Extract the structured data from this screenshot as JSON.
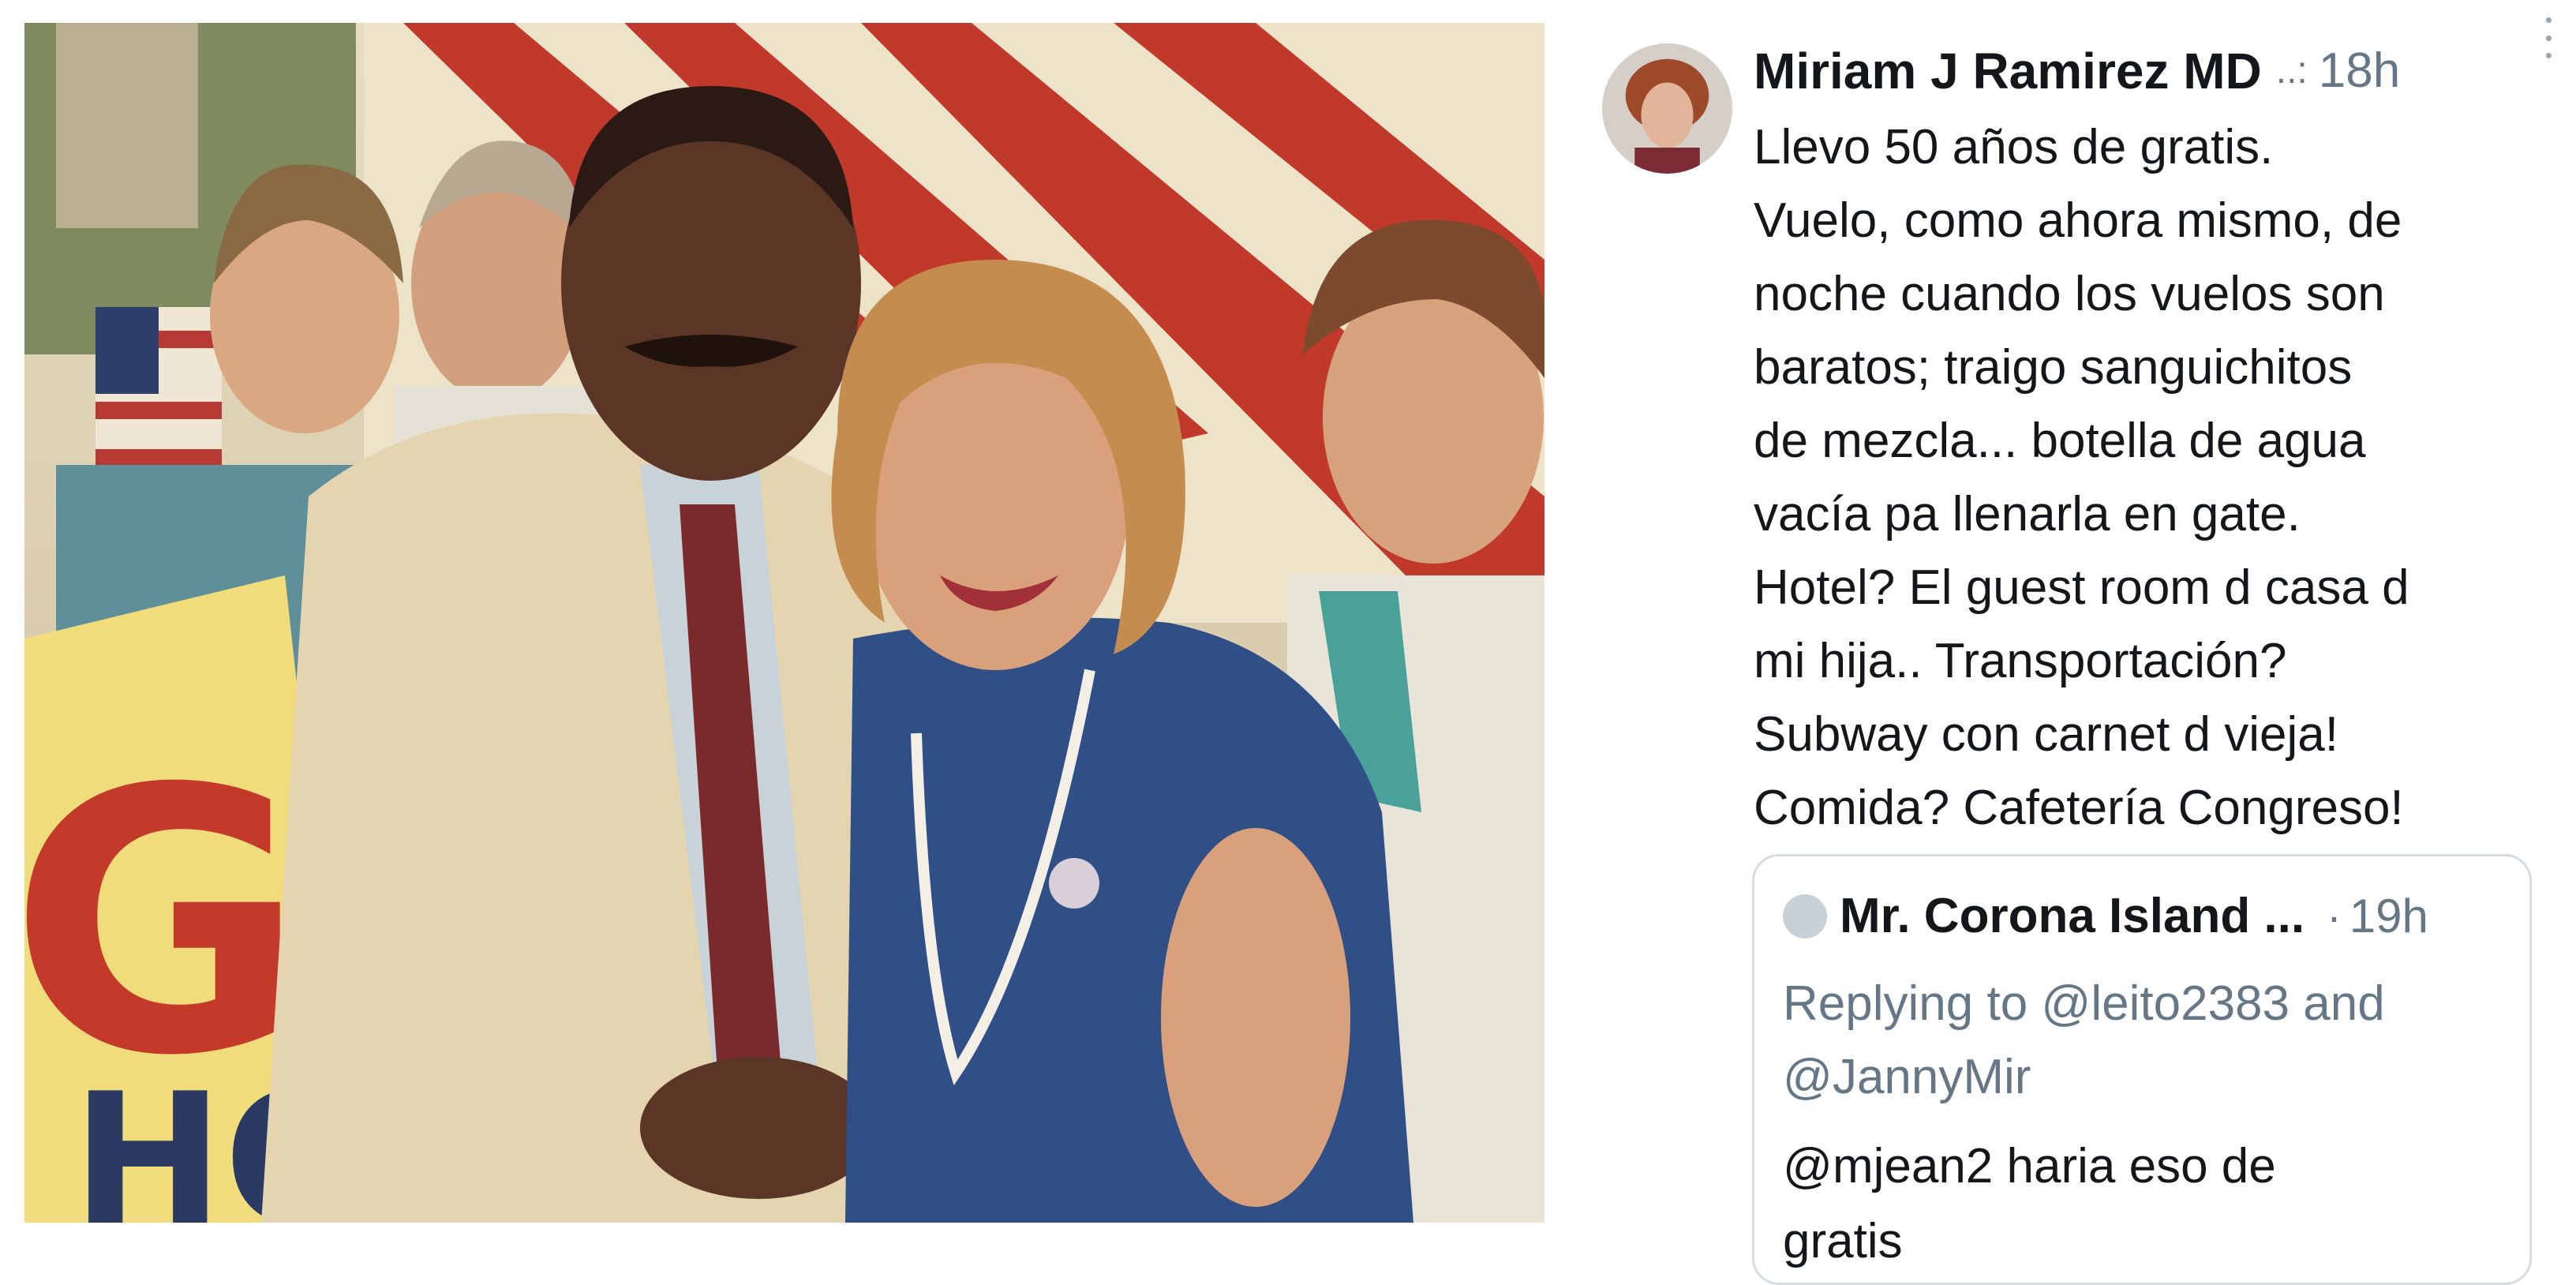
{
  "photo": {
    "banner_text": "G",
    "banner_text_bottom": "HOY"
  },
  "tweet": {
    "author": "Miriam J Ramirez MD",
    "author_truncation": "..:",
    "time": "18h",
    "more_icon": "vertical-ellipsis-icon",
    "body_lines": [
      "Llevo 50 años de gratis.",
      "Vuelo, como ahora mismo, de",
      "noche cuando los vuelos son",
      "baratos; traigo sanguichitos",
      "de mezcla... botella de agua",
      "vacía pa llenarla en gate.",
      "Hotel? El guest room d casa d",
      "mi hija.. Transportación?",
      "Subway con carnet d vieja!",
      "Comida? Cafetería Congreso!"
    ],
    "quoted": {
      "author": "Mr. Corona Island ...",
      "separator": "·",
      "time": "19h",
      "reply_lines": [
        "Replying to @leito2383 and",
        "@JannyMir"
      ],
      "body_lines": [
        "@mjean2 haria eso de",
        "gratis"
      ]
    }
  },
  "colors": {
    "text_primary": "#14171a",
    "text_secondary": "#657786",
    "card_border": "#d5dde3"
  }
}
